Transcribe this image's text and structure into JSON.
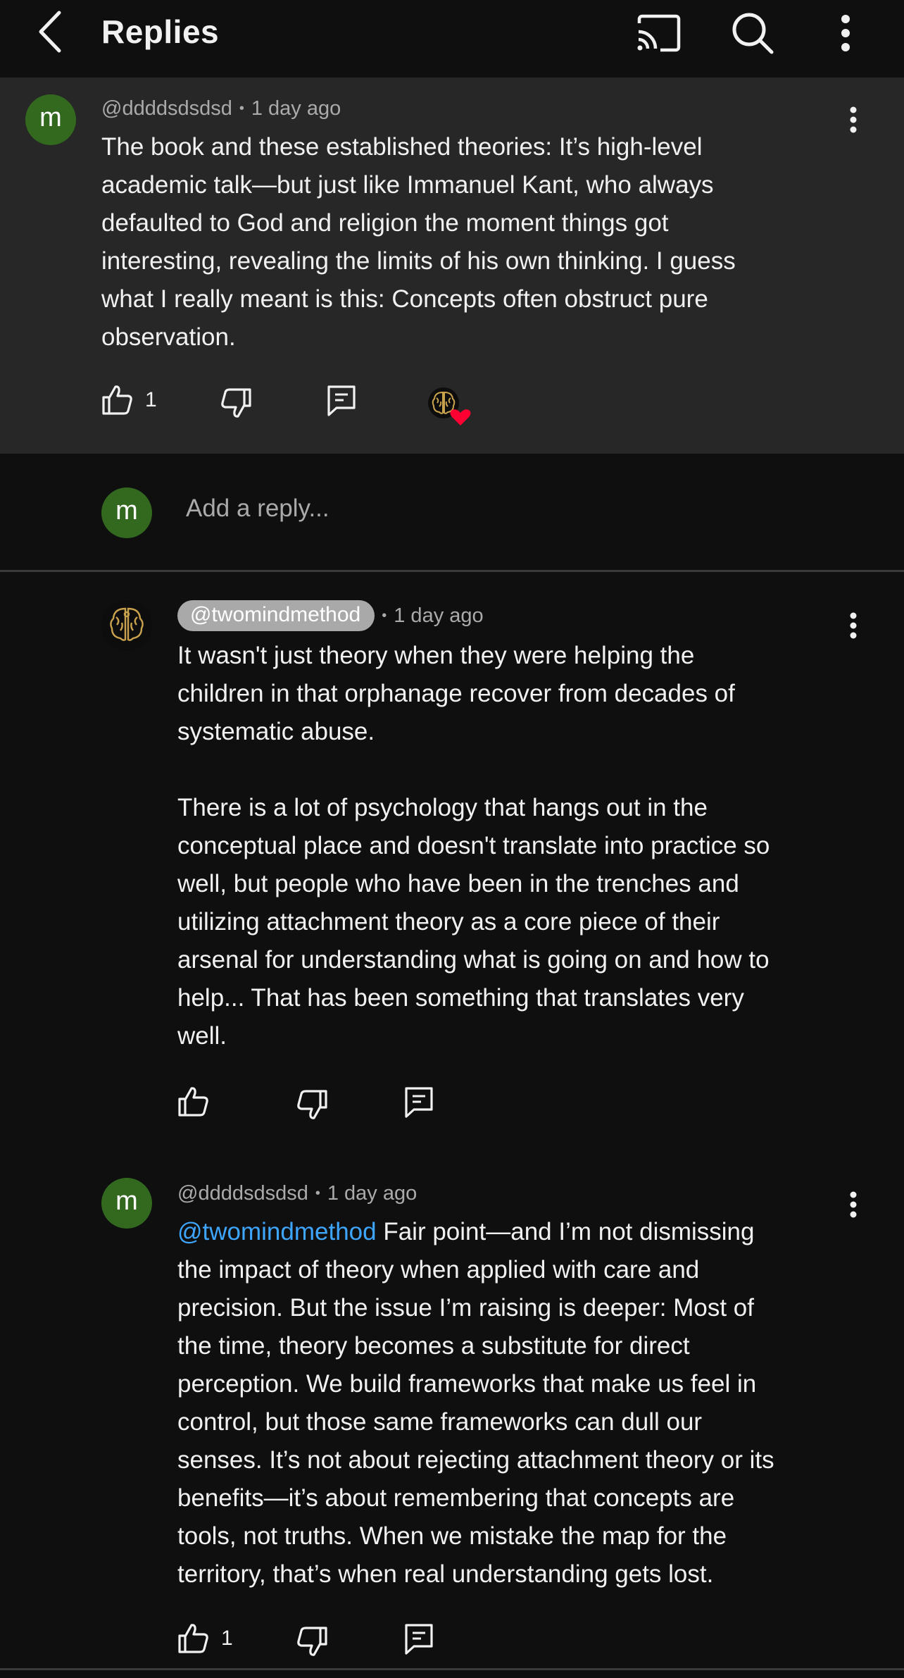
{
  "header": {
    "title": "Replies"
  },
  "parent_comment": {
    "avatar_letter": "m",
    "author": "@ddddsdsdsd",
    "time": "1 day ago",
    "text": "The book and these established theories: It’s high-level\nacademic talk—but just like Immanuel Kant, who always\ndefaulted to God and religion the moment things got\ninteresting, revealing the limits of his own thinking. I guess\nwhat I really meant is this: Concepts often obstruct pure\nobservation.",
    "likes": "1"
  },
  "add_reply": {
    "avatar_letter": "m",
    "placeholder": "Add a reply..."
  },
  "replies": [
    {
      "author": "@twomindmethod",
      "time": "1 day ago",
      "text": "It wasn't just theory when they were helping the\nchildren in that orphanage recover from decades of\nsystematic abuse.\n\nThere is a lot of psychology that hangs out in the\nconceptual place and doesn't translate into practice so\nwell, but people who have been in the trenches and\nutilizing attachment theory as a core piece of their\narsenal for understanding what is going on and how to\nhelp... That has been something that translates very\nwell.",
      "likes": ""
    },
    {
      "avatar_letter": "m",
      "author": "@ddddsdsdsd",
      "time": "1 day ago",
      "mention": "@twomindmethod",
      "text": " Fair point—and I’m not dismissing\nthe impact of theory when applied with care and\nprecision. But the issue I’m raising is deeper: Most of\nthe time, theory becomes a substitute for direct\nperception. We build frameworks that make us feel in\ncontrol, but those same frameworks can dull our\nsenses. It’s not about rejecting attachment theory or its\nbenefits—it’s about remembering that concepts are\ntools, not truths. When we mistake the map for the\nterritory, that’s when real understanding gets lost.",
      "likes": "1"
    }
  ],
  "meta_separator": "•",
  "colors": {
    "background": "#0f0f0f",
    "highlight_background": "#272727",
    "avatar_green": "#33691e",
    "mention_blue": "#3ea6ff",
    "heart_red": "#ff0033"
  },
  "icons": [
    "back-arrow-icon",
    "cast-icon",
    "search-icon",
    "more-vertical-icon",
    "thumbs-up-icon",
    "thumbs-down-icon",
    "reply-comment-icon",
    "creator-heart-icon",
    "brain-logo-icon"
  ]
}
